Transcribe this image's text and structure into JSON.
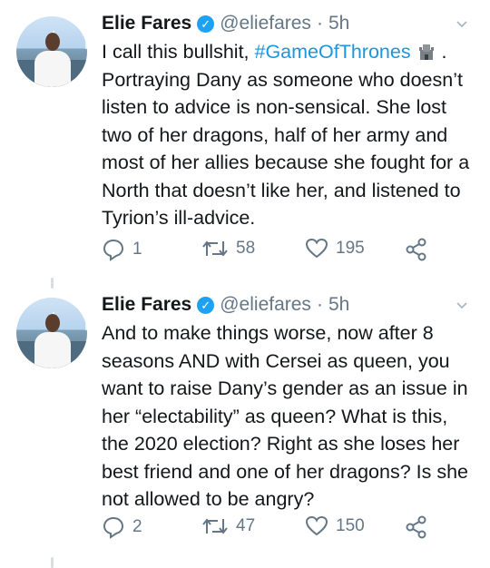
{
  "tweets": [
    {
      "name": "Elie Fares",
      "handle": "@eliefares",
      "separator": "·",
      "time": "5h",
      "text_pre": "I call this bullshit,",
      "hashtag": "#GameOfThrones",
      "text_line1_end": ".",
      "text_rest": "Portraying Dany as someone who doesn’t listen to advice is non-sensical. She lost two of her dragons, half of her army and most of her allies because she fought for a North that doesn’t like her, and listened to Tyrion’s ill-advice.",
      "replies": "1",
      "retweets": "58",
      "likes": "195"
    },
    {
      "name": "Elie Fares",
      "handle": "@eliefares",
      "separator": "·",
      "time": "5h",
      "text": "And to make things worse, now after 8 seasons AND with Cersei as queen, you want to raise Dany’s gender as an issue in her “electability” as queen? What is this, the 2020 election? Right as she loses her best friend and one of her dragons? Is she not allowed to be angry?",
      "replies": "2",
      "retweets": "47",
      "likes": "150"
    }
  ],
  "colors": {
    "verified": "#1da1f2",
    "hashtag": "#1b95e0",
    "meta": "#657786"
  },
  "icons": [
    "verified-icon",
    "castle-emoji-icon",
    "chevron-down-icon",
    "reply-icon",
    "retweet-icon",
    "like-icon",
    "share-icon"
  ]
}
